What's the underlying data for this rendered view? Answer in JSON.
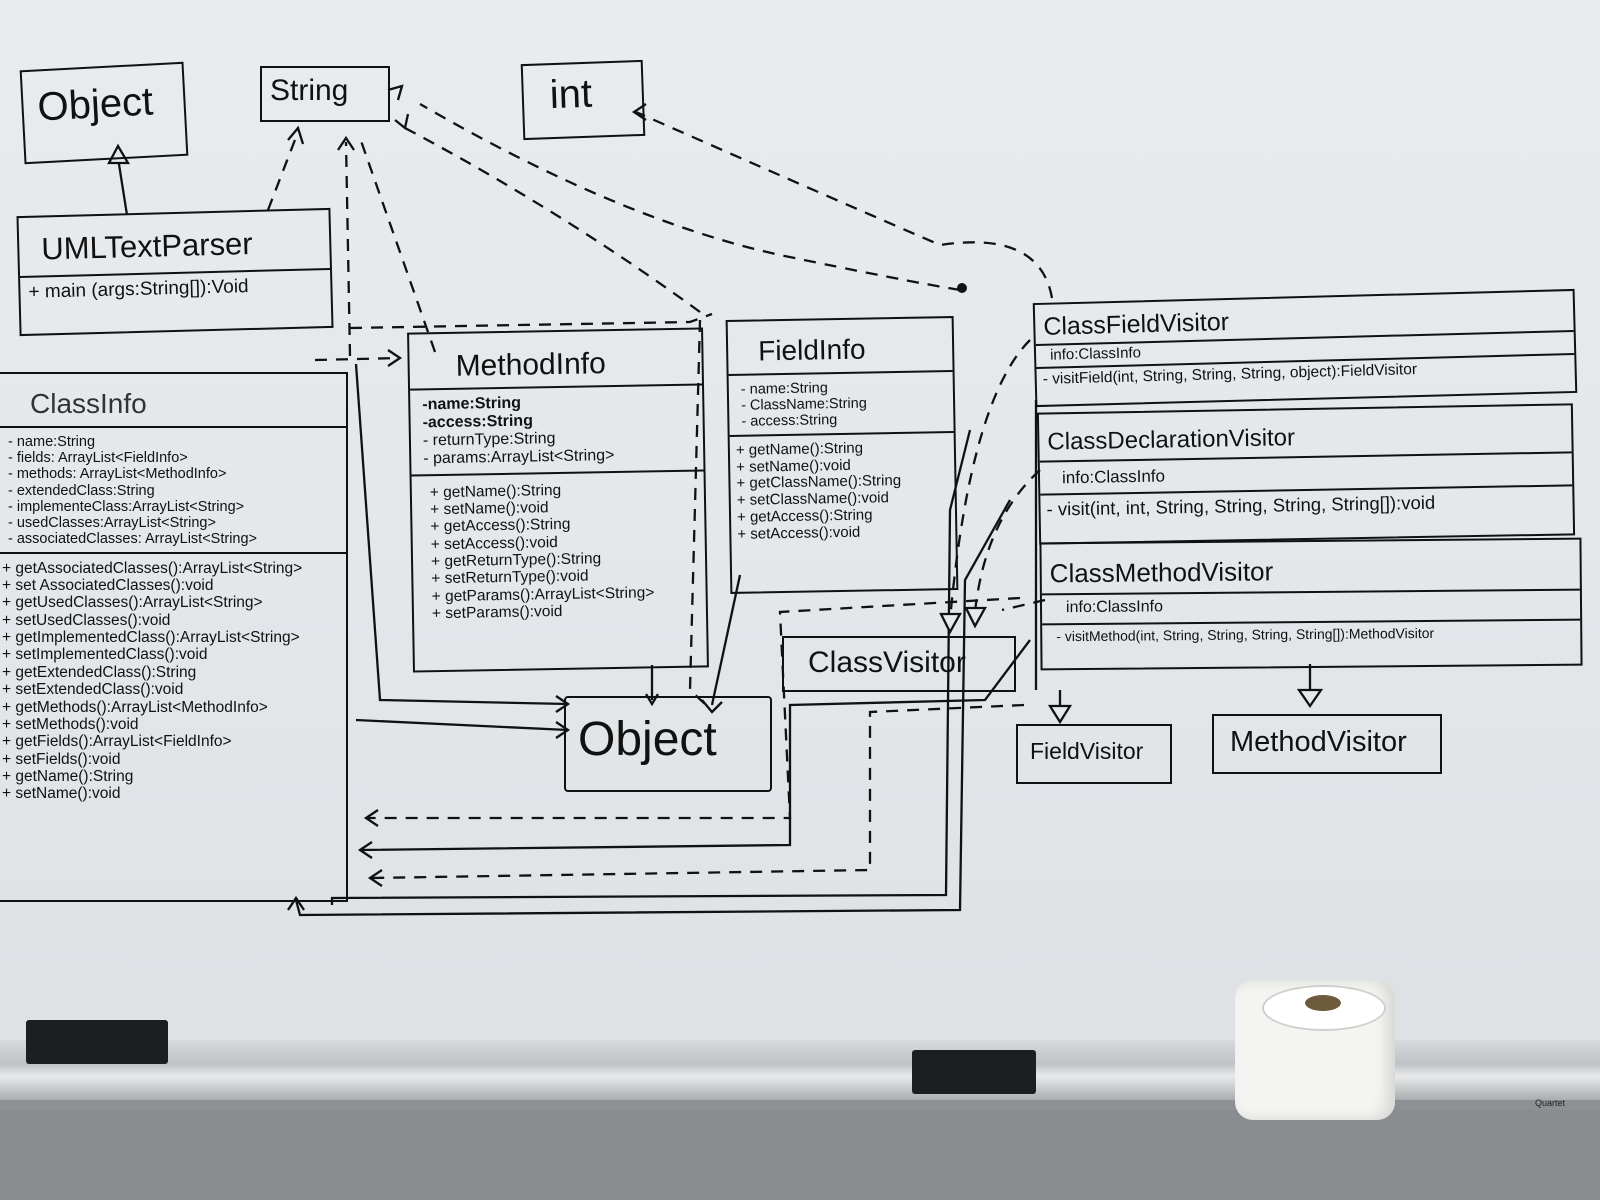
{
  "diagram": {
    "top_types": {
      "object": "Object",
      "string": "String",
      "int": "int"
    },
    "uml_text_parser": {
      "name": "UMLTextParser",
      "methods": [
        "+ main (args:String[]):Void"
      ]
    },
    "class_info": {
      "name": "ClassInfo",
      "fields": [
        "- name:String",
        "- fields: ArrayList<FieldInfo>",
        "- methods: ArrayList<MethodInfo>",
        "- extendedClass:String",
        "- implementeClass:ArrayList<String>",
        "- usedClasses:ArrayList<String>",
        "- associatedClasses: ArrayList<String>"
      ],
      "methods": [
        "+ getAssociatedClasses():ArrayList<String>",
        "+ set AssociatedClasses():void",
        "+ getUsedClasses():ArrayList<String>",
        "+ setUsedClasses():void",
        "+ getImplementedClass():ArrayList<String>",
        "+ setImplementedClass():void",
        "+ getExtendedClass():String",
        "+ setExtendedClass():void",
        "+ getMethods():ArrayList<MethodInfo>",
        "+ setMethods():void",
        "+ getFields():ArrayList<FieldInfo>",
        "+ setFields():void",
        "+ getName():String",
        "+ setName():void"
      ]
    },
    "method_info": {
      "name": "MethodInfo",
      "fields": [
        "-name:String",
        "-access:String",
        "- returnType:String",
        "- params:ArrayList<String>"
      ],
      "methods": [
        "+ getName():String",
        "+ setName():void",
        "+ getAccess():String",
        "+ setAccess():void",
        "+ getReturnType():String",
        "+ setReturnType():void",
        "+ getParams():ArrayList<String>",
        "+ setParams():void"
      ]
    },
    "field_info": {
      "name": "FieldInfo",
      "fields": [
        "- name:String",
        "- ClassName:String",
        "- access:String"
      ],
      "methods": [
        "+ getName():String",
        "+ setName():void",
        "+ getClassName():String",
        "+ setClassName():void",
        "+ getAccess():String",
        "+ setAccess():void"
      ]
    },
    "class_field_visitor": {
      "name": "ClassFieldVisitor",
      "fields": [
        "info:ClassInfo"
      ],
      "methods": [
        "- visitField(int, String, String, String, object):FieldVisitor"
      ]
    },
    "class_declaration_visitor": {
      "name": "ClassDeclarationVisitor",
      "fields": [
        "info:ClassInfo"
      ],
      "methods": [
        "- visit(int, int, String, String, String, String[]):void"
      ]
    },
    "class_method_visitor": {
      "name": "ClassMethodVisitor",
      "fields": [
        "info:ClassInfo"
      ],
      "methods": [
        "- visitMethod(int, String, String, String, String[]):MethodVisitor"
      ]
    },
    "object_center": "Object",
    "class_visitor": "ClassVisitor",
    "field_visitor": "FieldVisitor",
    "method_visitor": "MethodVisitor"
  },
  "colors": {
    "board": "#e6e9ec",
    "ink": "#111111",
    "tray": "#c3c7c9",
    "wall": "#8d9193"
  },
  "brand_mark": "Quartet"
}
